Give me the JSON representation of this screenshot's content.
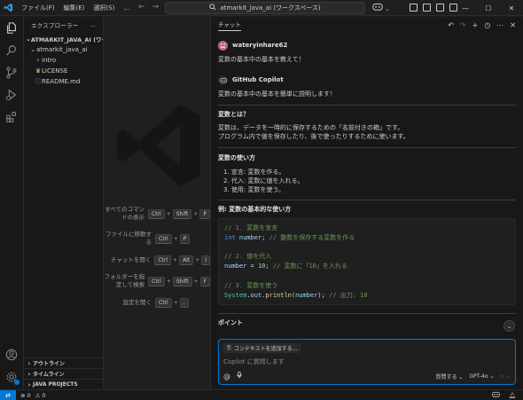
{
  "titlebar": {
    "menu": [
      "ファイル(F)",
      "編集(E)",
      "選択(S)",
      "…"
    ],
    "search": "atmarkit_java_ai (ワークスペース)"
  },
  "explorer": {
    "title": "エクスプローラー",
    "more": "…",
    "root": "ATMARKIT_JAVA_AI (ワーク...",
    "folder": "atmarkit_java_ai",
    "items": [
      "intro",
      "LICENSE",
      "README.md"
    ],
    "sections": [
      "アウトライン",
      "タイムライン",
      "JAVA PROJECTS"
    ]
  },
  "welcome": {
    "shortcuts": [
      {
        "label": "すべてのコマンドの表示",
        "keys": [
          "Ctrl",
          "Shift",
          "P"
        ]
      },
      {
        "label": "ファイルに移動する",
        "keys": [
          "Ctrl",
          "P"
        ]
      },
      {
        "label": "チャットを開く",
        "keys": [
          "Ctrl",
          "Alt",
          "I"
        ]
      },
      {
        "label": "フォルダーを指定して検索",
        "keys": [
          "Ctrl",
          "Shift",
          "F"
        ]
      },
      {
        "label": "設定を開く",
        "keys": [
          "Ctrl",
          ","
        ]
      }
    ]
  },
  "chat": {
    "tab": "チャット",
    "user": "wateryinhare62",
    "user_msg": "変数の基本中の基本を教えて！",
    "bot": "GitHub Copilot",
    "bot_intro": "変数の基本中の基本を簡単に説明します！",
    "h1": "変数とは？",
    "p1a": "変数は、データを一時的に保存するための「名前付きの箱」です。",
    "p1b": "プログラム内で値を保存したり、後で使ったりするために使います。",
    "h2": "変数の使い方",
    "steps": [
      "1. 宣言: 変数を作る。",
      "2. 代入: 変数に値を入れる。",
      "3. 使用: 変数を使う。"
    ],
    "h3": "例: 変数の基本的な使い方",
    "code": {
      "c1": "// 1. 変数を宣言",
      "l1_kw": "int",
      "l1_var": "number",
      "l1_com": "// 整数を保存する変数を作る",
      "c2": "// 2. 値を代入",
      "l2_var": "number",
      "l2_num": "10",
      "l2_com": "// 変数に「10」を入れる",
      "c3": "// 3. 変数を使う",
      "l3_cls": "System",
      "l3_out": "out",
      "l3_fn": "println",
      "l3_var": "number",
      "l3_com": "// 出力: 10"
    },
    "h4": "ポイント",
    "context_btn": "コンテキストを追加する...",
    "placeholder": "Copilot に質問します",
    "mode": "質問する",
    "model": "GPT-4o"
  },
  "status": {
    "errors": "0",
    "warnings": "0"
  }
}
